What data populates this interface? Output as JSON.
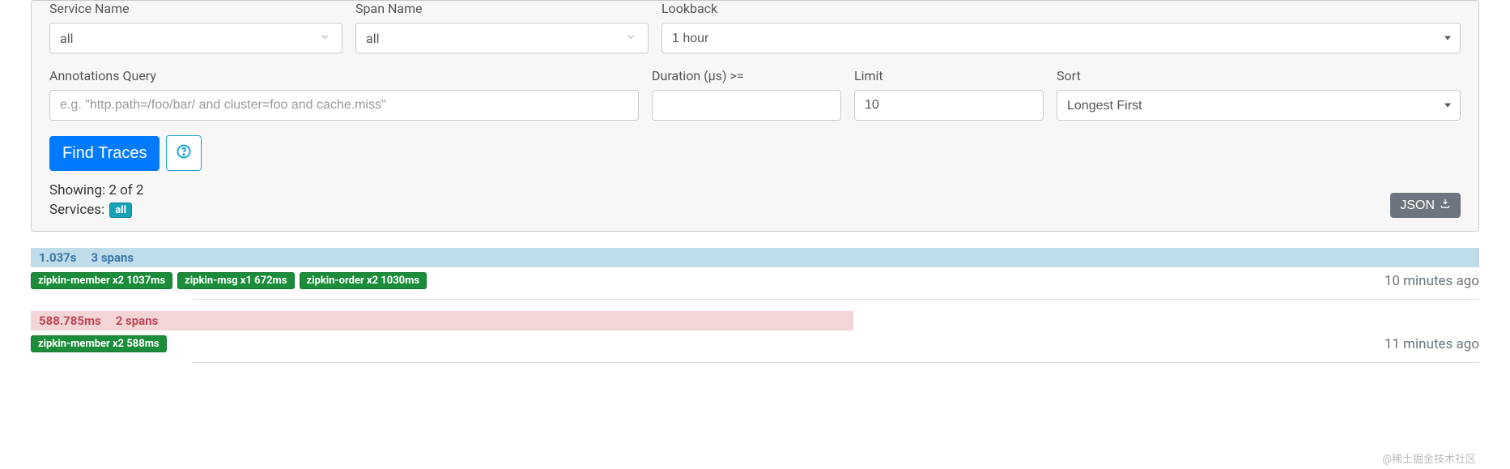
{
  "filters": {
    "service_name": {
      "label": "Service Name",
      "value": "all"
    },
    "span_name": {
      "label": "Span Name",
      "value": "all"
    },
    "lookback": {
      "label": "Lookback",
      "value": "1 hour"
    },
    "annotations": {
      "label": "Annotations Query",
      "placeholder": "e.g. \"http.path=/foo/bar/ and cluster=foo and cache.miss\"",
      "value": ""
    },
    "duration": {
      "label": "Duration (µs) >=",
      "value": ""
    },
    "limit": {
      "label": "Limit",
      "value": "10"
    },
    "sort": {
      "label": "Sort",
      "value": "Longest First"
    }
  },
  "actions": {
    "find_label": "Find Traces",
    "json_label": "JSON "
  },
  "status": {
    "showing": "Showing: 2 of 2",
    "services_label": "Services:",
    "services_badge": "all"
  },
  "traces": [
    {
      "kind": "success",
      "width_pct": 100,
      "duration": "1.037s",
      "span_count": "3 spans",
      "tags": [
        "zipkin-member x2 1037ms",
        "zipkin-msg x1 672ms",
        "zipkin-order x2 1030ms"
      ],
      "time_ago": "10 minutes ago"
    },
    {
      "kind": "error",
      "width_pct": 56.8,
      "duration": "588.785ms",
      "span_count": "2 spans",
      "tags": [
        "zipkin-member x2 588ms"
      ],
      "time_ago": "11 minutes ago"
    }
  ],
  "watermark": "@稀土掘金技术社区"
}
